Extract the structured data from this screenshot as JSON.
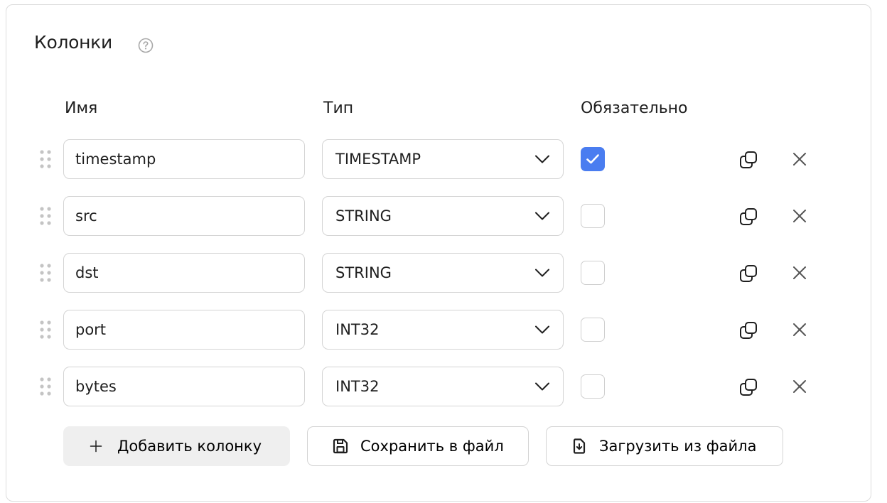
{
  "section": {
    "title": "Колонки",
    "help_icon": "question-circle-icon"
  },
  "columns_header": {
    "name": "Имя",
    "type": "Тип",
    "required": "Обязательно"
  },
  "rows": [
    {
      "name": "timestamp",
      "type": "TIMESTAMP",
      "required": true
    },
    {
      "name": "src",
      "type": "STRING",
      "required": false
    },
    {
      "name": "dst",
      "type": "STRING",
      "required": false
    },
    {
      "name": "port",
      "type": "INT32",
      "required": false
    },
    {
      "name": "bytes",
      "type": "INT32",
      "required": false
    }
  ],
  "actions": {
    "add_label": "Добавить колонку",
    "save_label": "Сохранить в файл",
    "load_label": "Загрузить из файла"
  },
  "colors": {
    "accent": "#4a7df0",
    "border": "#d4d4d4",
    "muted_button_bg": "#efefef"
  }
}
